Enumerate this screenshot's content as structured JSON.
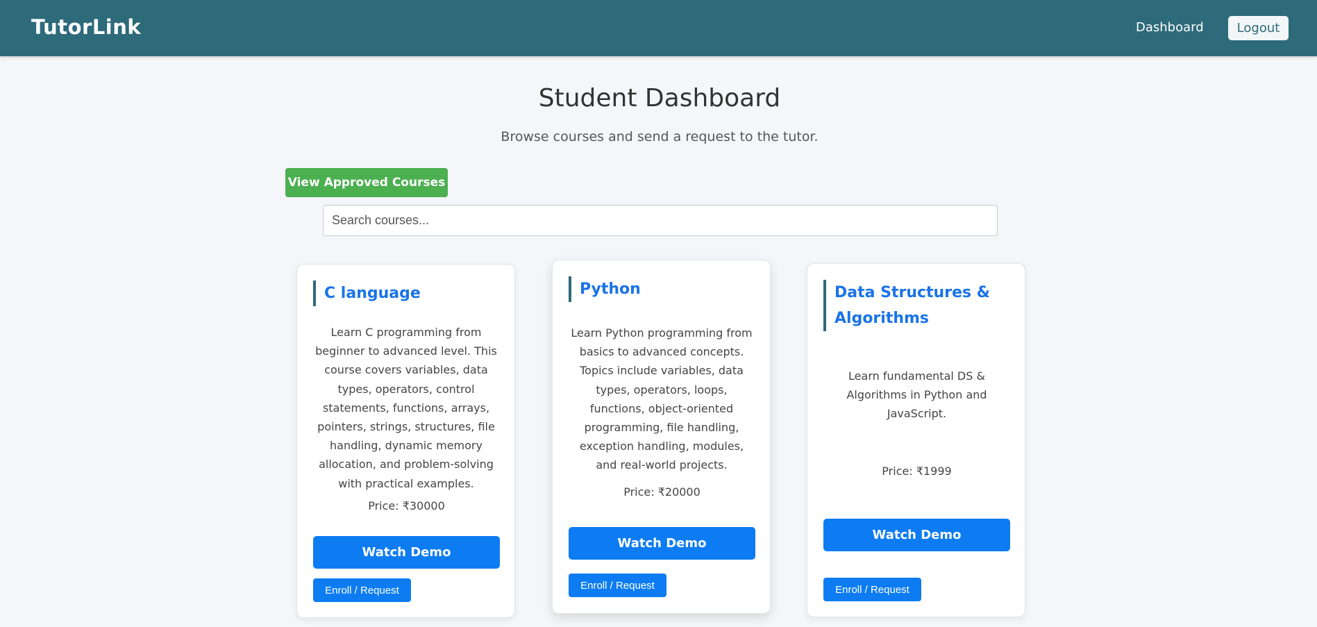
{
  "navbar": {
    "brand": "TutorLink",
    "dashboard_link": "Dashboard",
    "logout_label": "Logout"
  },
  "header": {
    "title": "Student Dashboard",
    "subtitle": "Browse courses and send a request to the tutor."
  },
  "actions": {
    "approved_label": "View Approved Courses"
  },
  "search": {
    "placeholder": "Search courses..."
  },
  "courses": [
    {
      "title": "C language",
      "description": "Learn C programming from beginner to advanced level. This course covers variables, data types, operators, control statements, functions, arrays, pointers, strings, structures, file handling, dynamic memory allocation, and problem-solving with practical examples.",
      "price": "Price: ₹30000",
      "demo_label": "Watch Demo",
      "enroll_label": "Enroll / Request"
    },
    {
      "title": "Python",
      "description": "Learn Python programming from basics to advanced concepts. Topics include variables, data types, operators, loops, functions, object-oriented programming, file handling, exception handling, modules, and real-world projects.",
      "price": "Price: ₹20000",
      "demo_label": "Watch Demo",
      "enroll_label": "Enroll / Request"
    },
    {
      "title": "Data Structures & Algorithms",
      "description": "Learn fundamental DS & Algorithms in Python and JavaScript.",
      "price": "Price: ₹1999",
      "demo_label": "Watch Demo",
      "enroll_label": "Enroll / Request"
    }
  ],
  "colors": {
    "navbar": "#2d6a7a",
    "primary_button": "#0d7cf2",
    "success_button": "#4caf50",
    "card_title": "#1a73e8",
    "page_background": "#f5f6fa"
  }
}
